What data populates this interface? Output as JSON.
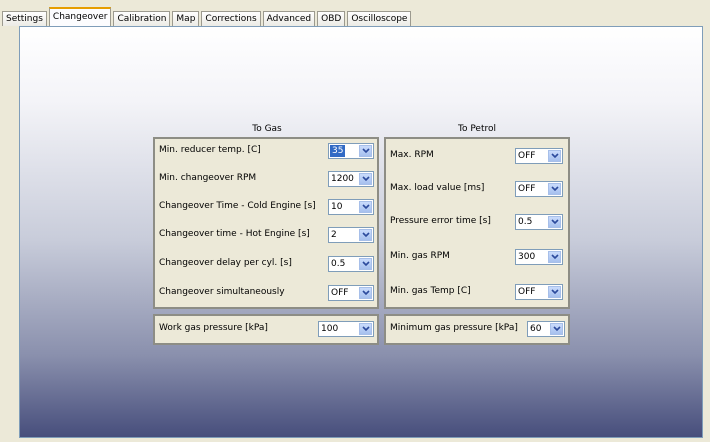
{
  "tabs": [
    "Settings",
    "Changeover",
    "Calibration",
    "Map",
    "Corrections",
    "Advanced",
    "OBD",
    "Oscilloscope"
  ],
  "active_tab": "Changeover",
  "to_gas": {
    "title": "To Gas",
    "rows": [
      {
        "label": "Min. reducer temp. [C]",
        "value": "35"
      },
      {
        "label": "Min. changeover RPM",
        "value": "1200"
      },
      {
        "label": "Changeover Time - Cold Engine [s]",
        "value": "10"
      },
      {
        "label": "Changeover time - Hot Engine [s]",
        "value": "2"
      },
      {
        "label": "Changeover delay per cyl. [s]",
        "value": "0.5"
      },
      {
        "label": "Changeover simultaneously",
        "value": "OFF"
      }
    ],
    "work_pressure": {
      "label": "Work gas pressure [kPa]",
      "value": "100"
    }
  },
  "to_petrol": {
    "title": "To Petrol",
    "rows": [
      {
        "label": "Max. RPM",
        "value": "OFF"
      },
      {
        "label": "Max. load value [ms]",
        "value": "OFF"
      },
      {
        "label": "Pressure error time [s]",
        "value": "0.5"
      },
      {
        "label": "Min. gas RPM",
        "value": "300"
      },
      {
        "label": "Min. gas Temp [C]",
        "value": "OFF"
      }
    ],
    "min_pressure": {
      "label": "Minimum gas pressure [kPa]",
      "value": "60"
    }
  }
}
